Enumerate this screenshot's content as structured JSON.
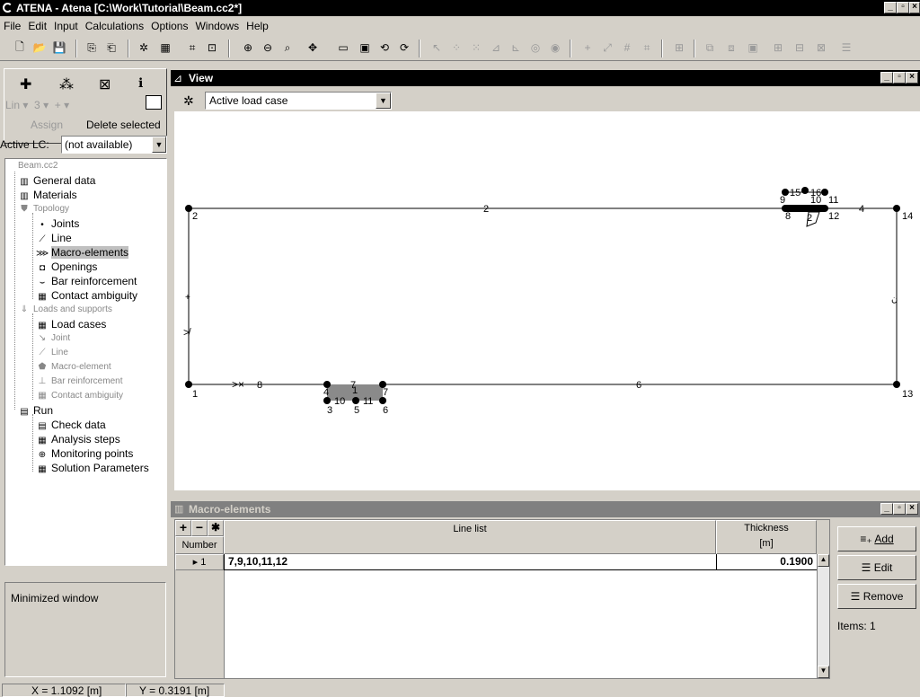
{
  "app": {
    "title": "ATENA - Atena [C:\\Work\\Tutorial\\Beam.cc2*]"
  },
  "menu": [
    "File",
    "Edit",
    "Input",
    "Calculations",
    "Options",
    "Windows",
    "Help"
  ],
  "toolbar_icons": [
    "new-icon",
    "open-icon",
    "save-icon",
    "copy-icon",
    "paste-icon",
    "select-icon",
    "grid-icon",
    "zoom-in-icon",
    "zoom-out-icon",
    "zoom-window-icon",
    "pan-icon",
    "rect-select-icon",
    "frame-icon",
    "rotate-icon",
    "rotate-fit-icon"
  ],
  "left": {
    "tool_labels": [
      "Lin",
      "3"
    ],
    "assign": "Assign",
    "delete_selected": "Delete selected",
    "active_lc_label": "Active LC:",
    "active_lc_value": "(not available)",
    "minimized": "Minimized window"
  },
  "tree": [
    {
      "label": "Beam.cc2",
      "icon": "",
      "grey": true
    },
    {
      "label": "General data",
      "icon": "grid-icon"
    },
    {
      "label": "Materials",
      "icon": "grid-icon"
    },
    {
      "label": "Topology",
      "icon": "shield-icon",
      "grey": true
    },
    {
      "label": "Joints",
      "icon": "joint-icon"
    },
    {
      "label": "Line",
      "icon": "line-icon"
    },
    {
      "label": "Macro-elements",
      "icon": "macro-icon",
      "selected": true
    },
    {
      "label": "Openings",
      "icon": "opening-icon"
    },
    {
      "label": "Bar reinforcement",
      "icon": "bar-icon"
    },
    {
      "label": "Contact ambiguity",
      "icon": "table-icon"
    },
    {
      "label": "Loads and supports",
      "icon": "load-icon",
      "grey": true
    },
    {
      "label": "Load cases",
      "icon": "table-icon"
    },
    {
      "label": "Joint",
      "icon": "joint-load-icon",
      "grey": true
    },
    {
      "label": "Line",
      "icon": "line-load-icon",
      "grey": true
    },
    {
      "label": "Macro-element",
      "icon": "macro-load-icon",
      "grey": true
    },
    {
      "label": "Bar reinforcement",
      "icon": "bar-load-icon",
      "grey": true
    },
    {
      "label": "Contact ambiguity",
      "icon": "table-icon",
      "grey": true
    },
    {
      "label": "Run",
      "icon": "run-icon"
    },
    {
      "label": "Check data",
      "icon": "check-icon"
    },
    {
      "label": "Analysis steps",
      "icon": "table-icon"
    },
    {
      "label": "Monitoring points",
      "icon": "monitor-icon"
    },
    {
      "label": "Solution Parameters",
      "icon": "table-icon"
    }
  ],
  "view": {
    "title": "View",
    "loadcase": "Active load case",
    "lines": [
      "1",
      "2",
      "3",
      "4",
      "5",
      "6",
      "7",
      "8",
      "9",
      "10",
      "11",
      "12"
    ],
    "joints": [
      "1",
      "2",
      "3",
      "4",
      "5",
      "6",
      "7",
      "8",
      "9",
      "10",
      "11",
      "12",
      "13",
      "14",
      "15",
      "16"
    ],
    "macro_labels": [
      "1",
      "2"
    ]
  },
  "macro": {
    "title": "Macro-elements",
    "col_number": "Number",
    "col_lines": "Line list",
    "col_thickness": "Thickness",
    "col_thickness_unit": "[m]",
    "rows": [
      {
        "number": "1",
        "lines": "7,9,10,11,12",
        "thickness": "0.1900"
      }
    ],
    "add": "Add",
    "edit": "Edit",
    "remove": "Remove",
    "items": "Items: 1",
    "hdr_buttons": [
      "+",
      "−",
      "✱"
    ]
  },
  "status": {
    "x": "X = 1.1092 [m]",
    "y": "Y = 0.3191 [m]"
  }
}
